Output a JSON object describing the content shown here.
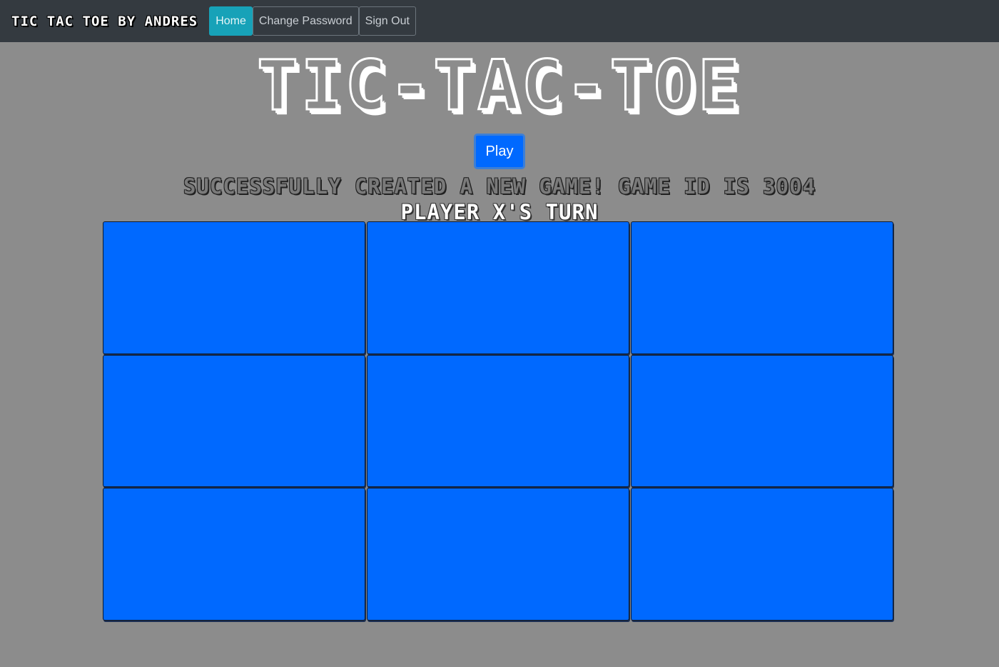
{
  "navbar": {
    "brand": "TIC TAC TOE BY ANDRES",
    "links": [
      "Home",
      "Change Password",
      "Sign Out"
    ],
    "active": "Home"
  },
  "main": {
    "title": "TIC-TAC-TOE",
    "play_label": "Play",
    "message": "SUCCESSFULLY CREATED A NEW GAME! GAME ID IS 3004",
    "turn": "PLAYER X'S TURN"
  },
  "board": {
    "cells": [
      "",
      "",
      "",
      "",
      "",
      "",
      "",
      "",
      ""
    ]
  },
  "colors": {
    "background": "#8c8c8c",
    "navbar": "#343a40",
    "active_link": "#17a2b8",
    "cell": "#0069ff"
  }
}
